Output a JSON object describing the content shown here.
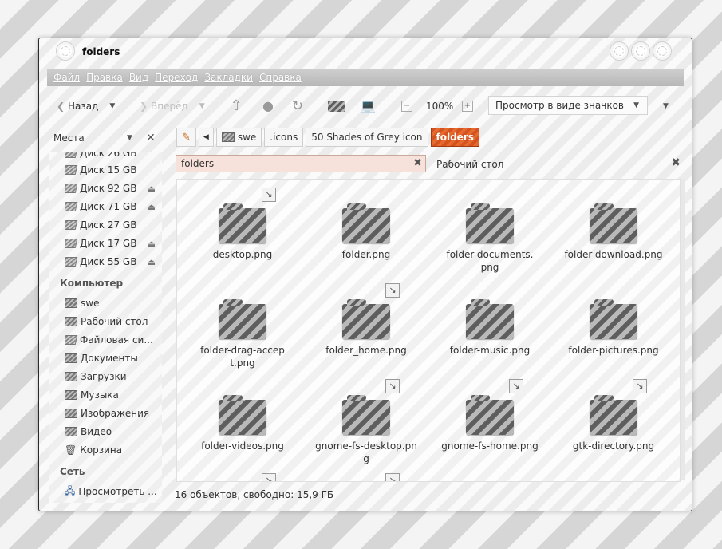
{
  "window": {
    "title": "folders"
  },
  "menu": [
    {
      "label": "Файл"
    },
    {
      "label": "Правка"
    },
    {
      "label": "Вид"
    },
    {
      "label": "Переход"
    },
    {
      "label": "Закладки"
    },
    {
      "label": "Справка"
    }
  ],
  "toolbar": {
    "back_label": "Назад",
    "forward_label": "Вперёд",
    "zoom_level": "100%",
    "view_mode": "Просмотр в виде значков"
  },
  "sidebar": {
    "header": "Места",
    "top_partial": "Диск 26 GB",
    "drives": [
      {
        "label": "Диск 15 GB",
        "eject": false
      },
      {
        "label": "Диск 92 GB",
        "eject": true
      },
      {
        "label": "Диск 71 GB",
        "eject": true
      },
      {
        "label": "Диск 27 GB",
        "eject": false
      },
      {
        "label": "Диск 17 GB",
        "eject": true
      },
      {
        "label": "Диск 55 GB",
        "eject": true
      }
    ],
    "computer_heading": "Компьютер",
    "places": [
      {
        "label": "swe"
      },
      {
        "label": "Рабочий стол"
      },
      {
        "label": "Файловая си..."
      },
      {
        "label": "Документы"
      },
      {
        "label": "Загрузки"
      },
      {
        "label": "Музыка"
      },
      {
        "label": "Изображения"
      },
      {
        "label": "Видео"
      },
      {
        "label": "Корзина"
      }
    ],
    "network_heading": "Сеть",
    "network_items": [
      {
        "label": "Просмотреть ..."
      }
    ]
  },
  "pathbar": {
    "crumbs": [
      {
        "label": "swe"
      },
      {
        "label": ".icons"
      },
      {
        "label": "50 Shades of Grey icon"
      },
      {
        "label": "folders",
        "active": true
      }
    ]
  },
  "location": {
    "value": "folders"
  },
  "second_pane": {
    "label": "Рабочий стол"
  },
  "files": [
    {
      "name": "desktop.png"
    },
    {
      "name": "folder.png"
    },
    {
      "name": "folder-documents.png"
    },
    {
      "name": "folder-download.png"
    },
    {
      "name": "folder-drag-accept.png"
    },
    {
      "name": "folder_home.png"
    },
    {
      "name": "folder-music.png"
    },
    {
      "name": "folder-pictures.png"
    },
    {
      "name": "folder-videos.png"
    },
    {
      "name": "gnome-fs-desktop.png"
    },
    {
      "name": "gnome-fs-home.png"
    },
    {
      "name": "gtk-directory.png"
    }
  ],
  "status": {
    "text": "16 объектов, свободно: 15,9 ГБ"
  }
}
